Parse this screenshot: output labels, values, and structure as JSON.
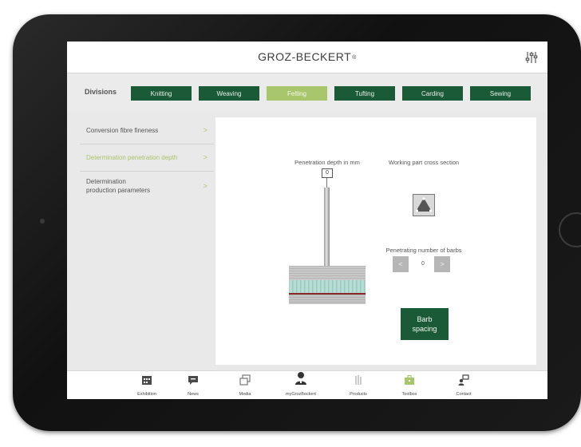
{
  "header": {
    "logo_text": "GROZ-BECKERT",
    "logo_mark": "®"
  },
  "divisions": {
    "label": "Divisions",
    "tabs": [
      {
        "label": "Knitting",
        "active": false
      },
      {
        "label": "Weaving",
        "active": false
      },
      {
        "label": "Felting",
        "active": true
      },
      {
        "label": "Tufting",
        "active": false
      },
      {
        "label": "Carding",
        "active": false
      },
      {
        "label": "Sewing",
        "active": false
      }
    ]
  },
  "sidebar": {
    "items": [
      {
        "label": "Conversion fibre fineness",
        "active": false
      },
      {
        "label": "Determination penetration depth",
        "active": true
      },
      {
        "label_line1": "Determination",
        "label_line2": "production parameters",
        "active": false
      }
    ],
    "chevron": ">"
  },
  "panel": {
    "penetration_caption": "Penetration depth in mm",
    "penetration_value": "0",
    "cross_section_caption": "Working part cross section",
    "barbs_caption": "Penetrating number of barbs",
    "barbs_value": "0",
    "decrement": "<",
    "increment": ">",
    "barb_button_line1": "Barb",
    "barb_button_line2": "spacing"
  },
  "bottom_nav": {
    "items": [
      {
        "label": "Exhibition",
        "icon": "calendar-icon"
      },
      {
        "label": "News",
        "icon": "chat-bubble-icon"
      },
      {
        "label": "Media",
        "icon": "media-stack-icon"
      },
      {
        "label": "myGrozBeckert",
        "icon": "person-icon"
      },
      {
        "label": "Products",
        "icon": "needles-icon"
      },
      {
        "label": "Toolbox",
        "icon": "toolbox-icon"
      },
      {
        "label": "Contact",
        "icon": "contact-icon"
      }
    ]
  },
  "colors": {
    "brand_green": "#1b5a36",
    "active_green": "#a8c66c"
  }
}
